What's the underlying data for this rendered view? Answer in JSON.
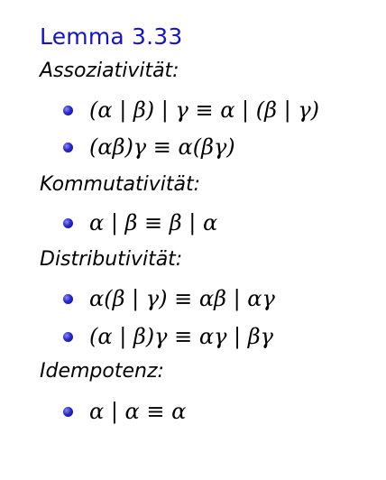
{
  "title": "Lemma 3.33",
  "sections": [
    {
      "heading": "Assoziativität:",
      "items": [
        "(α | β) | γ ≡ α | (β | γ)",
        "(αβ)γ ≡ α(βγ)"
      ]
    },
    {
      "heading": "Kommutativität:",
      "items": [
        "α | β ≡ β | α"
      ]
    },
    {
      "heading": "Distributivität:",
      "items": [
        "α(β | γ) ≡ αβ | αγ",
        "(α | β)γ ≡ αγ | βγ"
      ]
    },
    {
      "heading": "Idempotenz:",
      "items": [
        "α | α ≡ α"
      ]
    }
  ],
  "colors": {
    "title": "#1414c8",
    "bullet": "#2a2ac8",
    "text": "#000000"
  }
}
